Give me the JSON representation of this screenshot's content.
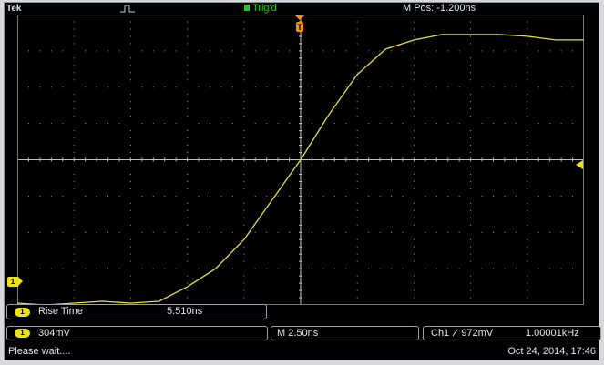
{
  "header": {
    "brand": "Tek",
    "trigger_status": "Trig'd",
    "horizontal_position": "M Pos: -1.200ns"
  },
  "markers": {
    "channel_marker": "1",
    "trigger_position_marker": "T"
  },
  "measurement": {
    "channel": "1",
    "name": "Rise Time",
    "value": "5.510ns"
  },
  "readouts": {
    "channel": "1",
    "volts_per_div": "304mV",
    "time_per_div": "M 2.50ns",
    "trigger_source": "Ch1",
    "trigger_slope_icon": "rising-edge-icon",
    "trigger_level": "972mV",
    "trigger_frequency": "1.00001kHz"
  },
  "status": {
    "message": "Please wait....",
    "datetime": "Oct 24, 2014, 17:46"
  },
  "colors": {
    "trace": "#e8e03a",
    "trigger_green": "#1ec81e",
    "trigger_orange": "#ff8c1a",
    "grid": "#a0a0a0"
  },
  "chart_data": {
    "type": "line",
    "grid": true,
    "x_divisions": 10,
    "y_divisions": 8,
    "series": [
      {
        "x": [
          -5.0,
          -4.5,
          -4.0,
          -3.5,
          -3.0,
          -2.5,
          -2.0,
          -1.5,
          -1.0,
          -0.5,
          0.0,
          0.5,
          1.0,
          1.5,
          2.0,
          2.5,
          3.0,
          3.5,
          4.0,
          4.5,
          5.0
        ],
        "y": [
          -3.95,
          -4.0,
          -3.95,
          -3.9,
          -3.95,
          -3.9,
          -3.5,
          -3.0,
          -2.2,
          -1.1,
          0.0,
          1.25,
          2.35,
          3.05,
          3.3,
          3.45,
          3.45,
          3.45,
          3.4,
          3.3,
          3.3
        ]
      }
    ]
  }
}
